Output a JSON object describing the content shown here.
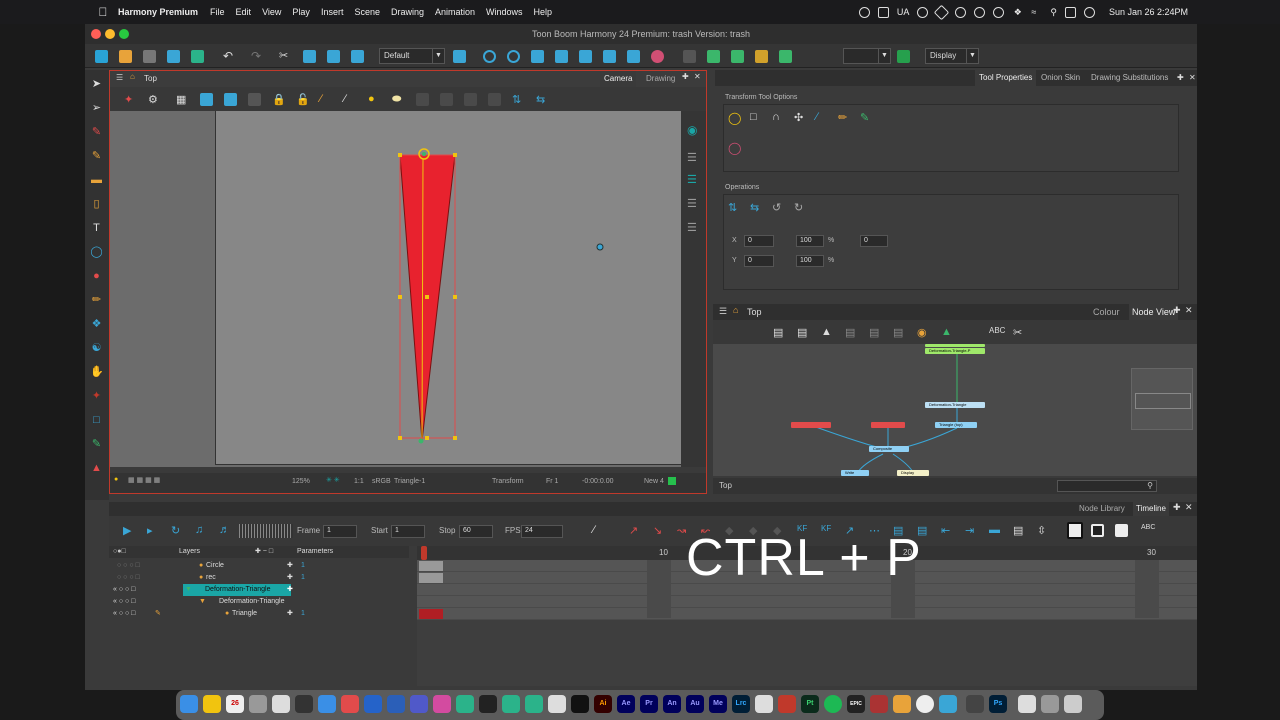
{
  "menubar": {
    "apple": "",
    "app": "Harmony Premium",
    "items": [
      "File",
      "Edit",
      "View",
      "Play",
      "Insert",
      "Scene",
      "Drawing",
      "Animation",
      "Windows",
      "Help"
    ],
    "lang": "UA",
    "clock": "Sun Jan 26  2:24PM"
  },
  "window": {
    "title": "Toon Boom Harmony 24 Premium: trash Version: trash"
  },
  "toolbar": {
    "preset": "Default",
    "display": "Display"
  },
  "camera": {
    "title": "Top",
    "tabs": [
      "Camera",
      "Drawing"
    ],
    "zoom": "125%",
    "ratio": "1:1",
    "color_space": "sRGB",
    "layer": "Triangle-1",
    "tool": "Transform",
    "frame": "Fr 1",
    "time": "-0:00:0.00",
    "new": "New 4"
  },
  "toolprops": {
    "tabs": [
      "Tool Properties",
      "Onion Skin",
      "Drawing Substitutions"
    ],
    "section1": "Transform Tool Options",
    "section2": "Operations",
    "x": "0",
    "y": "0",
    "w": "100",
    "h": "100",
    "pct": "%",
    "angle": "0"
  },
  "nodeview": {
    "title": "Top",
    "tabs": [
      "Colour",
      "Node View"
    ],
    "footer": "Top",
    "nodes": [
      "Deformation-Triangle-P",
      "Deformation-Triangle",
      "Triangle (top)",
      "Composite",
      "Write",
      "Display"
    ]
  },
  "timeline": {
    "tabs": [
      "Node Library",
      "Timeline"
    ],
    "frame_label": "Frame",
    "frame": "1",
    "start_label": "Start",
    "start": "1",
    "stop_label": "Stop",
    "stop": "60",
    "fps_label": "FPS",
    "fps": "24",
    "layers_label": "Layers",
    "params_label": "Parameters",
    "ruler": [
      "10",
      "20",
      "30"
    ],
    "layers": [
      {
        "name": "Circle",
        "val": "1"
      },
      {
        "name": "rec",
        "val": "1"
      },
      {
        "name": "Deformation-Triangle",
        "val": ""
      },
      {
        "name": "Deformation-Triangle",
        "val": ""
      },
      {
        "name": "Triangle",
        "val": "1"
      }
    ]
  },
  "overlay": "CTRL + P",
  "dock": [
    "",
    "",
    "26",
    "",
    "",
    "",
    "",
    "",
    "",
    "",
    "",
    "",
    "",
    "",
    "",
    "",
    "",
    "",
    "",
    "",
    "",
    "Ai",
    "Ae",
    "Pr",
    "An",
    "Au",
    "Me",
    "Lrc",
    "",
    "",
    "Pt",
    "",
    "EPIC",
    "",
    "",
    "",
    "",
    "",
    "",
    "Ps",
    "",
    ""
  ],
  "colors": {
    "accent": "#c0392b",
    "triangle": "#e8222e",
    "selection": "#1aa6a6"
  }
}
